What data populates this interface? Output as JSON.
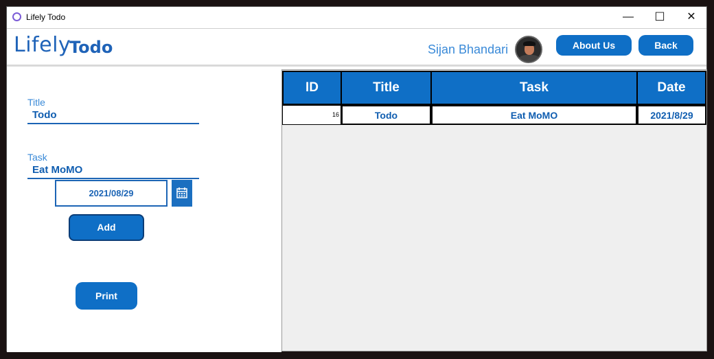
{
  "window": {
    "title": "Lifely Todo",
    "controls": {
      "minimize": "—",
      "maximize": "☐",
      "close": "✕"
    }
  },
  "header": {
    "logo_part1": "Lifely",
    "logo_part2": "Todo",
    "username": "Sijan Bhandari",
    "about_label": "About Us",
    "back_label": "Back"
  },
  "form": {
    "title_label": "Title",
    "title_value": "Todo",
    "task_label": "Task",
    "task_value": "Eat MoMO",
    "date_value": "2021/08/29",
    "add_label": "Add",
    "print_label": "Print"
  },
  "table": {
    "columns": [
      "ID",
      "Title",
      "Task",
      "Date"
    ],
    "rows": [
      {
        "id": "16",
        "title": "Todo",
        "task": "Eat MoMO",
        "date": "2021/8/29"
      }
    ]
  },
  "colors": {
    "accent": "#0f6fc6",
    "text_blue": "#0f5db0",
    "background": "#1a1212"
  }
}
